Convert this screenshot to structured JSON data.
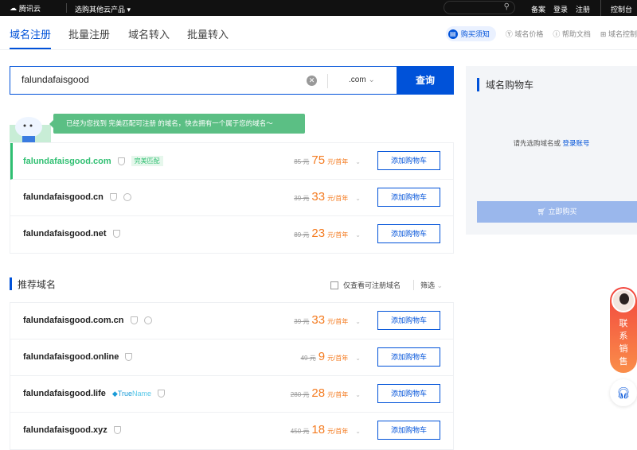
{
  "topbar": {
    "logo": "腾讯云",
    "products": "选购其他云产品",
    "links": [
      "备案",
      "登录",
      "注册"
    ],
    "console": "控制台"
  },
  "tabs": [
    {
      "label": "域名注册"
    },
    {
      "label": "批量注册"
    },
    {
      "label": "域名转入"
    },
    {
      "label": "批量转入"
    }
  ],
  "right_links": {
    "notice": "购买须知",
    "price": "域名价格",
    "help": "帮助文档",
    "console": "域名控制"
  },
  "search": {
    "value": "falundafaisgood",
    "tld": ".com",
    "button": "查询"
  },
  "tip": "已经为您找到 完美匹配可注册 的域名，快去拥有一个属于您的域名～",
  "results": [
    {
      "name": "falundafaisgood.com",
      "badge": "完美匹配",
      "old": "85 元",
      "price": "75",
      "unit": "元/首年",
      "button": "添加购物车"
    },
    {
      "name": "falundafaisgood.cn",
      "old": "39 元",
      "price": "33",
      "unit": "元/首年",
      "button": "添加购物车"
    },
    {
      "name": "falundafaisgood.net",
      "old": "89 元",
      "price": "23",
      "unit": "元/首年",
      "button": "添加购物车"
    }
  ],
  "recommend": {
    "title": "推荐域名",
    "only_available": "仅查看可注册域名",
    "filter": "筛选",
    "items": [
      {
        "name": "falundafaisgood.com.cn",
        "old": "39 元",
        "price": "33",
        "unit": "元/首年",
        "button": "添加购物车"
      },
      {
        "name": "falundafaisgood.online",
        "old": "49 元",
        "price": "9",
        "unit": "元/首年",
        "button": "添加购物车"
      },
      {
        "name": "falundafaisgood.life",
        "truename_a": "True",
        "truename_b": "Name",
        "old": "280 元",
        "price": "28",
        "unit": "元/首年",
        "button": "添加购物车"
      },
      {
        "name": "falundafaisgood.xyz",
        "old": "450 元",
        "price": "18",
        "unit": "元/首年",
        "button": "添加购物车"
      }
    ]
  },
  "cart": {
    "title": "域名购物车",
    "empty": "请先选购域名或",
    "login": "登录账号",
    "buy": "立即购买"
  },
  "contact": [
    "联",
    "系",
    "销",
    "售"
  ]
}
